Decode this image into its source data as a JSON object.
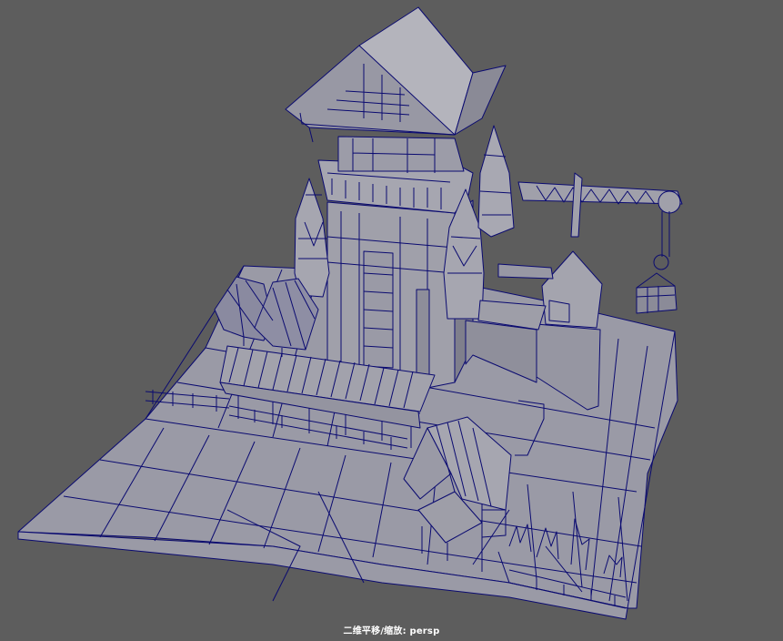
{
  "viewport": {
    "camera_status": "二维平移/缩放: persp",
    "background_color": "#5d5d5d",
    "wire_color": "#0a0a70",
    "surface_color": "#9a9aa6"
  },
  "scene": {
    "objects": [
      "ground-plane",
      "watch-tower",
      "corner-turrets",
      "tower-crane",
      "hanging-cargo-crate",
      "guard-house",
      "long-shed",
      "small-hut",
      "wooden-fence",
      "pine-trees",
      "shrubs"
    ]
  }
}
